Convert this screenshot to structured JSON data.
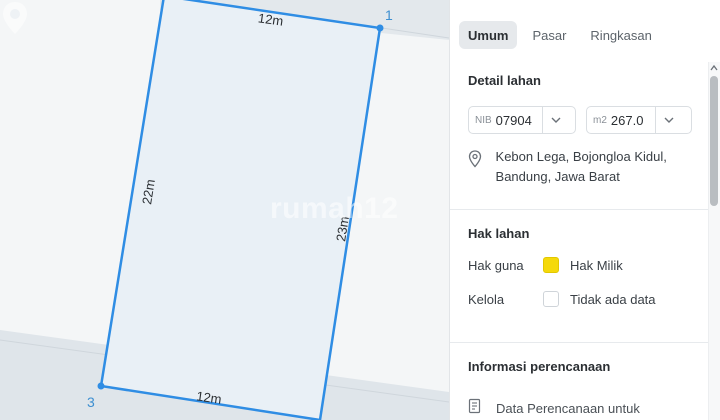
{
  "map": {
    "edges": {
      "top": "12m",
      "left": "22m",
      "right": "23m",
      "bottom": "12m"
    },
    "vertices": {
      "v1": "1",
      "v3": "3"
    },
    "watermark": "rumah12",
    "colors": {
      "boundary": "#2f8de4",
      "fill": "#e9f0f6",
      "road": "#dde3e8"
    }
  },
  "tabs": [
    {
      "label": "Umum",
      "active": true
    },
    {
      "label": "Pasar",
      "active": false
    },
    {
      "label": "Ringkasan",
      "active": false
    }
  ],
  "detail": {
    "title": "Detail lahan",
    "nib": {
      "prefix": "NIB",
      "value": "07904"
    },
    "area": {
      "prefix": "m2",
      "value": "267.0"
    },
    "address_line1": "Kebon Lega, Bojongloa Kidul,",
    "address_line2": "Bandung, Jawa Barat"
  },
  "hak": {
    "title": "Hak lahan",
    "guna_label": "Hak guna",
    "guna_value": "Hak Milik",
    "guna_color": "#f5d90a",
    "kelola_label": "Kelola",
    "kelola_value": "Tidak ada data"
  },
  "info": {
    "title": "Informasi perencanaan",
    "doc_label": "Data Perencanaan untuk"
  }
}
